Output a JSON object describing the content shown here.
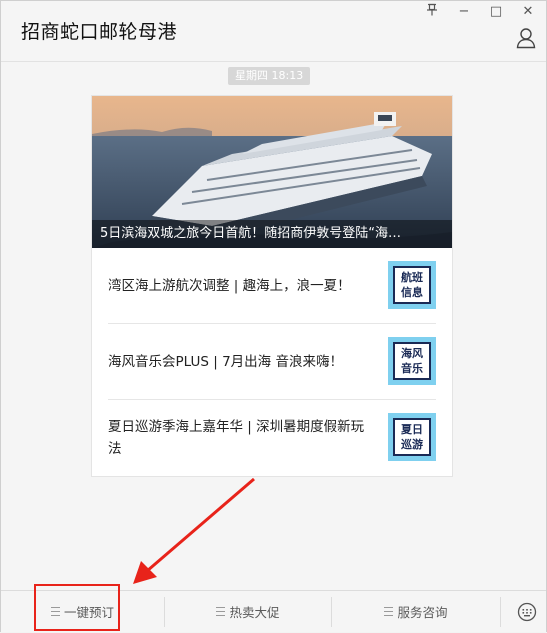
{
  "window": {
    "title": "招商蛇口邮轮母港",
    "controls": {
      "pin": "⊥",
      "minimize": "−",
      "maximize": "□",
      "close": "✕"
    }
  },
  "chat": {
    "timestamp": "星期四  18:13"
  },
  "article": {
    "hero_caption": "5日滨海双城之旅今日首航！随招商伊敦号登陆“海…",
    "items": [
      {
        "title": "湾区海上游航次调整 | 趣海上，浪一夏！",
        "thumb_text": "航班\n信息"
      },
      {
        "title": "海风音乐会PLUS | 7月出海 音浪来嗨！",
        "thumb_text": "海风\n音乐"
      },
      {
        "title": "夏日巡游季海上嘉年华 | 深圳暑期度假新玩法",
        "thumb_text": "夏日\n巡游"
      }
    ]
  },
  "menu": {
    "items": [
      "一键预订",
      "热卖大促",
      "服务咨询"
    ]
  },
  "colors": {
    "highlight": "#e8231a",
    "thumb_bg": "#7fd0ef",
    "thumb_border": "#1a2a55"
  },
  "icons": {
    "user": "user-icon",
    "keyboard": "keyboard-icon",
    "menu": "hamburger-icon"
  }
}
